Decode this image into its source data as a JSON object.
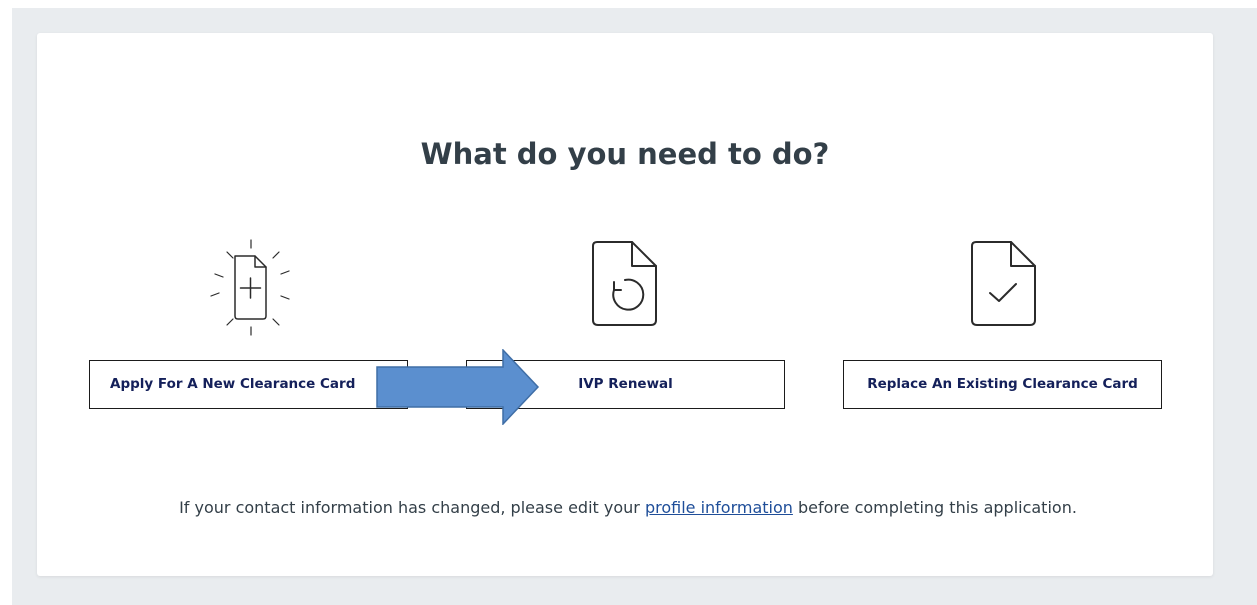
{
  "header": {
    "title": "What do you need to do?"
  },
  "options": [
    {
      "label": "Apply For A New Clearance Card",
      "icon": "new-document-icon"
    },
    {
      "label": "IVP Renewal",
      "icon": "renew-document-icon"
    },
    {
      "label": "Replace An Existing Clearance Card",
      "icon": "checked-document-icon"
    }
  ],
  "annotation": {
    "arrow_color": "#5b8fcf",
    "arrow_border": "#3f6ea6",
    "icon": "right-arrow-icon"
  },
  "footer": {
    "text_before": "If your contact information has changed, please edit your ",
    "link_label": "profile information",
    "text_after": " before completing this application."
  },
  "colors": {
    "title": "#333f48",
    "button_text": "#14205a",
    "link": "#1f4e99",
    "background": "#e9ecef"
  }
}
